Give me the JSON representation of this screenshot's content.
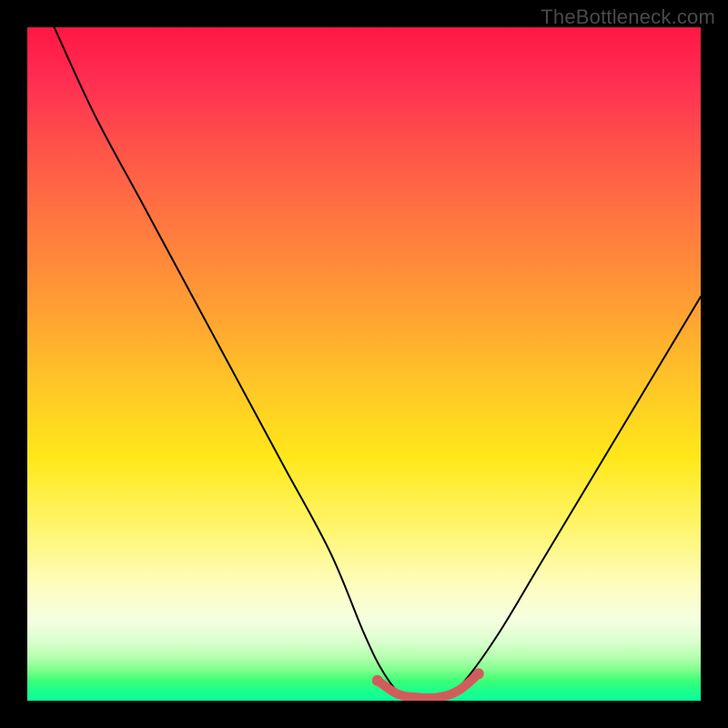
{
  "watermark": "TheBottleneck.com",
  "chart_data": {
    "type": "line",
    "title": "",
    "xlabel": "",
    "ylabel": "",
    "xlim": [
      0,
      100
    ],
    "ylim": [
      0,
      100
    ],
    "grid": false,
    "legend": null,
    "series": [
      {
        "name": "bottleneck-curve",
        "x": [
          4,
          10,
          17,
          24,
          31,
          38,
          45,
          50,
          53,
          56,
          59,
          62,
          65,
          70,
          76,
          82,
          88,
          94,
          100
        ],
        "y": [
          100,
          87,
          74,
          61,
          48,
          35,
          22,
          10,
          4,
          0.5,
          0,
          0.5,
          3,
          10,
          20,
          30,
          40,
          50,
          60
        ]
      },
      {
        "name": "highlight-flat",
        "x": [
          52,
          55,
          58,
          61,
          64,
          67
        ],
        "y": [
          3,
          1,
          0.5,
          0.5,
          1.5,
          4
        ]
      }
    ],
    "colors": {
      "curve": "#000000",
      "highlight": "#d25c5c"
    }
  }
}
